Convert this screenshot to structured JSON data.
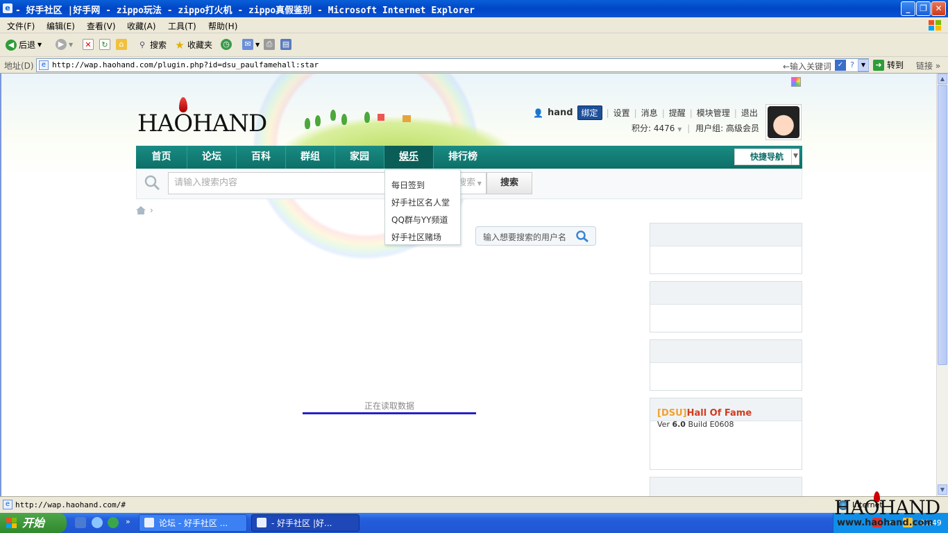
{
  "window": {
    "title": "- 好手社区 |好手网 - zippo玩法 - zippo打火机 - zippo真假鉴别 - Microsoft Internet Explorer"
  },
  "menubar": [
    "文件(F)",
    "编辑(E)",
    "查看(V)",
    "收藏(A)",
    "工具(T)",
    "帮助(H)"
  ],
  "toolbar": {
    "back": "后退",
    "search": "搜索",
    "favorites": "收藏夹"
  },
  "address": {
    "label": "地址(D)",
    "url": "http://wap.haohand.com/plugin.php?id=dsu_paulfamehall:star",
    "hint": "←输入关键词",
    "go": "转到",
    "links": "链接"
  },
  "header": {
    "logo": "HAOHAND",
    "username": "hand",
    "bind": "绑定",
    "links": [
      "设置",
      "消息",
      "提醒",
      "模块管理",
      "退出"
    ],
    "points": "积分: 4476",
    "group": "用户组: 高级会员"
  },
  "nav": {
    "items": [
      "首页",
      "论坛",
      "百科",
      "群组",
      "家园",
      "娱乐",
      "排行榜"
    ],
    "quick": "快捷导航"
  },
  "search": {
    "placeholder": "请输入搜索内容",
    "type": "搜索",
    "button": "搜索"
  },
  "dropdown": [
    "每日签到",
    "好手社区名人堂",
    "QQ群与YY频道",
    "好手社区赌场"
  ],
  "user_search": {
    "placeholder": "输入想要搜索的用户名"
  },
  "loading": "正在读取数据",
  "sidebar": {
    "hof_title_bracket": "[DSU]",
    "hof_title_main": "Hall Of Fame",
    "hof_ver_pre": "Ver ",
    "hof_ver_num": "6.0",
    "hof_ver_post": " Build E0608"
  },
  "status": {
    "text": "http://wap.haohand.com/#",
    "zone": "Internet"
  },
  "taskbar": {
    "start": "开始",
    "tasks": [
      "论坛 - 好手社区 ...",
      "- 好手社区 |好..."
    ],
    "clock": "20:49"
  },
  "watermark": {
    "logo": "HAOHAND",
    "url": "www.haohand.com"
  },
  "colors": {
    "nav": "#0c6f67",
    "hof_bracket": "#f0a030",
    "hof_main": "#d23b1f",
    "loadbar": "#2622c4"
  }
}
